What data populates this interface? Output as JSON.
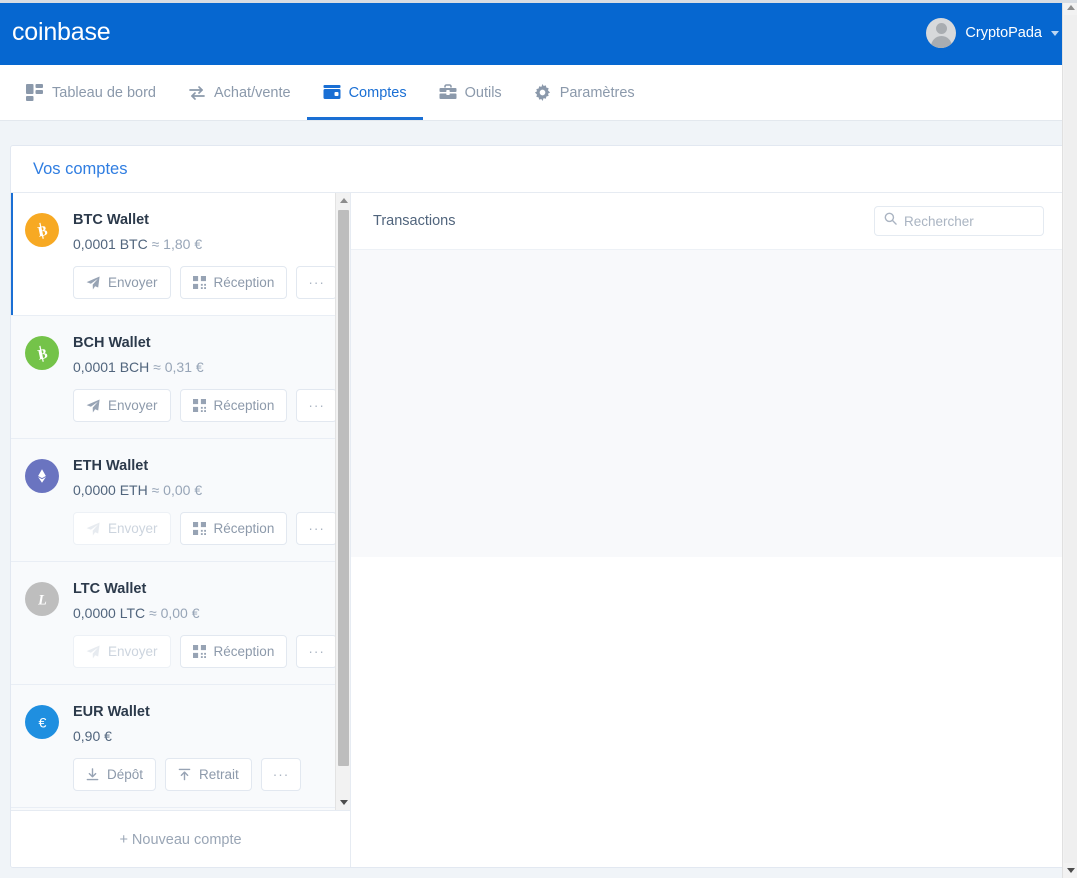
{
  "header": {
    "brand": "coinbase",
    "brand_color": "#0667d0",
    "username": "CryptoPada",
    "avatar_icon": "user-avatar-icon",
    "caret_icon": "chevron-down-icon"
  },
  "nav": {
    "items": [
      {
        "label": "Tableau de bord",
        "icon": "dashboard-grid-icon",
        "active": false
      },
      {
        "label": "Achat/vente",
        "icon": "exchange-arrows-icon",
        "active": false
      },
      {
        "label": "Comptes",
        "icon": "wallet-icon",
        "active": true
      },
      {
        "label": "Outils",
        "icon": "toolbox-icon",
        "active": false
      },
      {
        "label": "Paramètres",
        "icon": "gear-icon",
        "active": false
      }
    ],
    "active_color": "#1a6fd4",
    "inactive_color": "#8b99ab"
  },
  "accounts_panel": {
    "title": "Vos comptes",
    "new_account_label": "+ Nouveau compte",
    "wallets": [
      {
        "name": "BTC Wallet",
        "amount": "0,0001 BTC",
        "approx": "≈",
        "fiat": "1,80 €",
        "icon": "bitcoin-icon",
        "color": "#f7a923",
        "selected": true,
        "buttons": [
          {
            "label": "Envoyer",
            "icon": "send-paper-plane-icon",
            "disabled": false
          },
          {
            "label": "Réception",
            "icon": "qr-code-icon",
            "disabled": false
          },
          {
            "label": "···",
            "icon": "more-options-icon",
            "disabled": false
          }
        ]
      },
      {
        "name": "BCH Wallet",
        "amount": "0,0001 BCH",
        "approx": "≈",
        "fiat": "0,31 €",
        "icon": "bitcoin-cash-icon",
        "color": "#74c349",
        "selected": false,
        "buttons": [
          {
            "label": "Envoyer",
            "icon": "send-paper-plane-icon",
            "disabled": false
          },
          {
            "label": "Réception",
            "icon": "qr-code-icon",
            "disabled": false
          },
          {
            "label": "···",
            "icon": "more-options-icon",
            "disabled": false
          }
        ]
      },
      {
        "name": "ETH Wallet",
        "amount": "0,0000 ETH",
        "approx": "≈",
        "fiat": "0,00 €",
        "icon": "ethereum-icon",
        "color": "#6a74c0",
        "selected": false,
        "buttons": [
          {
            "label": "Envoyer",
            "icon": "send-paper-plane-icon",
            "disabled": true
          },
          {
            "label": "Réception",
            "icon": "qr-code-icon",
            "disabled": false
          },
          {
            "label": "···",
            "icon": "more-options-icon",
            "disabled": false
          }
        ]
      },
      {
        "name": "LTC Wallet",
        "amount": "0,0000 LTC",
        "approx": "≈",
        "fiat": "0,00 €",
        "icon": "litecoin-icon",
        "color": "#bebebe",
        "selected": false,
        "buttons": [
          {
            "label": "Envoyer",
            "icon": "send-paper-plane-icon",
            "disabled": true
          },
          {
            "label": "Réception",
            "icon": "qr-code-icon",
            "disabled": false
          },
          {
            "label": "···",
            "icon": "more-options-icon",
            "disabled": false
          }
        ]
      },
      {
        "name": "EUR Wallet",
        "amount": "0,90 €",
        "approx": "",
        "fiat": "",
        "icon": "euro-icon",
        "color": "#1f8fe0",
        "selected": false,
        "buttons": [
          {
            "label": "Dépôt",
            "icon": "download-arrow-icon",
            "disabled": false
          },
          {
            "label": "Retrait",
            "icon": "upload-arrow-icon",
            "disabled": false
          },
          {
            "label": "···",
            "icon": "more-options-icon",
            "disabled": false
          }
        ]
      }
    ]
  },
  "transactions_panel": {
    "title": "Transactions",
    "search_placeholder": "Rechercher",
    "search_value": "",
    "search_icon": "search-icon",
    "rows": []
  }
}
